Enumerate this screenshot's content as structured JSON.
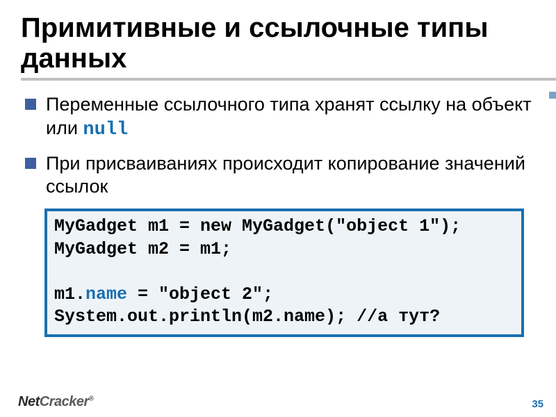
{
  "title": "Примитивные и ссылочные типы данных",
  "bullets": [
    {
      "text": "Переменные ссылочного типа хранят ссылку на объект или ",
      "tail_code": "null"
    },
    {
      "text": "При присваиваниях происходит копирование значений ссылок",
      "tail_code": ""
    }
  ],
  "code": {
    "l1a": "MyGadget m1 = new MyGadget(\"object 1\");",
    "l2": "MyGadget m2 = m1;",
    "l3": "",
    "l4a": "m1.",
    "l4b": "name",
    "l4c": " = \"object 2\";",
    "l5": "System.out.println(m2.name); //а тут?"
  },
  "footer": {
    "logo_a": "Net",
    "logo_b": "Cracker",
    "reg": "®",
    "page": "35"
  }
}
